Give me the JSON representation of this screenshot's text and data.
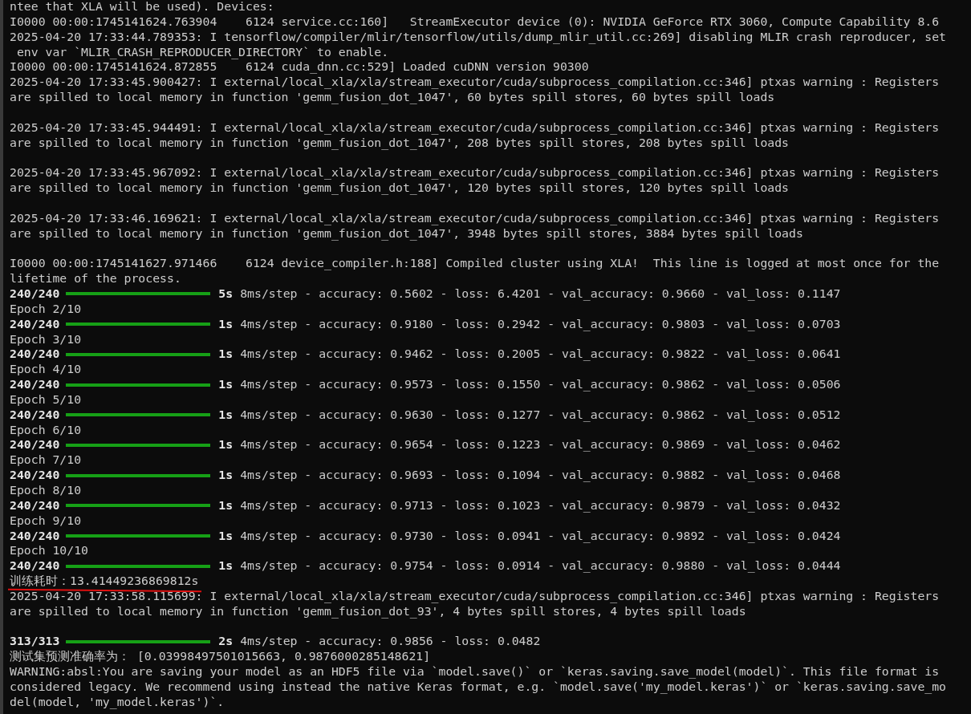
{
  "lines": [
    {
      "kind": "text",
      "text": "ntee that XLA will be used). Devices:"
    },
    {
      "kind": "text",
      "text": "I0000 00:00:1745141624.763904    6124 service.cc:160]   StreamExecutor device (0): NVIDIA GeForce RTX 3060, Compute Capability 8.6"
    },
    {
      "kind": "text",
      "text": "2025-04-20 17:33:44.789353: I tensorflow/compiler/mlir/tensorflow/utils/dump_mlir_util.cc:269] disabling MLIR crash reproducer, set"
    },
    {
      "kind": "text",
      "text": " env var `MLIR_CRASH_REPRODUCER_DIRECTORY` to enable."
    },
    {
      "kind": "text",
      "text": "I0000 00:00:1745141624.872855    6124 cuda_dnn.cc:529] Loaded cuDNN version 90300"
    },
    {
      "kind": "text",
      "text": "2025-04-20 17:33:45.900427: I external/local_xla/xla/stream_executor/cuda/subprocess_compilation.cc:346] ptxas warning : Registers"
    },
    {
      "kind": "text",
      "text": "are spilled to local memory in function 'gemm_fusion_dot_1047', 60 bytes spill stores, 60 bytes spill loads"
    },
    {
      "kind": "blank"
    },
    {
      "kind": "text",
      "text": "2025-04-20 17:33:45.944491: I external/local_xla/xla/stream_executor/cuda/subprocess_compilation.cc:346] ptxas warning : Registers"
    },
    {
      "kind": "text",
      "text": "are spilled to local memory in function 'gemm_fusion_dot_1047', 208 bytes spill stores, 208 bytes spill loads"
    },
    {
      "kind": "blank"
    },
    {
      "kind": "text",
      "text": "2025-04-20 17:33:45.967092: I external/local_xla/xla/stream_executor/cuda/subprocess_compilation.cc:346] ptxas warning : Registers"
    },
    {
      "kind": "text",
      "text": "are spilled to local memory in function 'gemm_fusion_dot_1047', 120 bytes spill stores, 120 bytes spill loads"
    },
    {
      "kind": "blank"
    },
    {
      "kind": "text",
      "text": "2025-04-20 17:33:46.169621: I external/local_xla/xla/stream_executor/cuda/subprocess_compilation.cc:346] ptxas warning : Registers"
    },
    {
      "kind": "text",
      "text": "are spilled to local memory in function 'gemm_fusion_dot_1047', 3948 bytes spill stores, 3884 bytes spill loads"
    },
    {
      "kind": "blank"
    },
    {
      "kind": "text",
      "text": "I0000 00:00:1745141627.971466    6124 device_compiler.h:188] Compiled cluster using XLA!  This line is logged at most once for the"
    },
    {
      "kind": "text",
      "text": "lifetime of the process."
    },
    {
      "kind": "progress",
      "count": "240/240",
      "level": 1,
      "time": "5s",
      "rest": "8ms/step - accuracy: 0.5602 - loss: 6.4201 - val_accuracy: 0.9660 - val_loss: 0.1147"
    },
    {
      "kind": "text",
      "text": "Epoch 2/10"
    },
    {
      "kind": "progress",
      "count": "240/240",
      "level": 1,
      "time": "1s",
      "rest": "4ms/step - accuracy: 0.9180 - loss: 0.2942 - val_accuracy: 0.9803 - val_loss: 0.0703"
    },
    {
      "kind": "text",
      "text": "Epoch 3/10"
    },
    {
      "kind": "progress",
      "count": "240/240",
      "level": 1,
      "time": "1s",
      "rest": "4ms/step - accuracy: 0.9462 - loss: 0.2005 - val_accuracy: 0.9822 - val_loss: 0.0641"
    },
    {
      "kind": "text",
      "text": "Epoch 4/10"
    },
    {
      "kind": "progress",
      "count": "240/240",
      "level": 1,
      "time": "1s",
      "rest": "4ms/step - accuracy: 0.9573 - loss: 0.1550 - val_accuracy: 0.9862 - val_loss: 0.0506"
    },
    {
      "kind": "text",
      "text": "Epoch 5/10"
    },
    {
      "kind": "progress",
      "count": "240/240",
      "level": 1,
      "time": "1s",
      "rest": "4ms/step - accuracy: 0.9630 - loss: 0.1277 - val_accuracy: 0.9862 - val_loss: 0.0512"
    },
    {
      "kind": "text",
      "text": "Epoch 6/10"
    },
    {
      "kind": "progress",
      "count": "240/240",
      "level": 1,
      "time": "1s",
      "rest": "4ms/step - accuracy: 0.9654 - loss: 0.1223 - val_accuracy: 0.9869 - val_loss: 0.0462"
    },
    {
      "kind": "text",
      "text": "Epoch 7/10"
    },
    {
      "kind": "progress",
      "count": "240/240",
      "level": 1,
      "time": "1s",
      "rest": "4ms/step - accuracy: 0.9693 - loss: 0.1094 - val_accuracy: 0.9882 - val_loss: 0.0468"
    },
    {
      "kind": "text",
      "text": "Epoch 8/10"
    },
    {
      "kind": "progress",
      "count": "240/240",
      "level": 1,
      "time": "1s",
      "rest": "4ms/step - accuracy: 0.9713 - loss: 0.1023 - val_accuracy: 0.9879 - val_loss: 0.0432"
    },
    {
      "kind": "text",
      "text": "Epoch 9/10"
    },
    {
      "kind": "progress",
      "count": "240/240",
      "level": 1,
      "time": "1s",
      "rest": "4ms/step - accuracy: 0.9730 - loss: 0.0941 - val_accuracy: 0.9892 - val_loss: 0.0424"
    },
    {
      "kind": "text",
      "text": "Epoch 10/10"
    },
    {
      "kind": "progress",
      "count": "240/240",
      "level": 1,
      "time": "1s",
      "rest": "4ms/step - accuracy: 0.9754 - loss: 0.0914 - val_accuracy: 0.9880 - val_loss: 0.0444"
    },
    {
      "kind": "text",
      "text": "训练耗时：13.41449236869812s",
      "underlined": true
    },
    {
      "kind": "text",
      "text": "2025-04-20 17:33:58.115699: I external/local_xla/xla/stream_executor/cuda/subprocess_compilation.cc:346] ptxas warning : Registers"
    },
    {
      "kind": "text",
      "text": "are spilled to local memory in function 'gemm_fusion_dot_93', 4 bytes spill stores, 4 bytes spill loads"
    },
    {
      "kind": "blank"
    },
    {
      "kind": "progress",
      "count": "313/313",
      "level": 1,
      "time": "2s",
      "rest": "4ms/step - accuracy: 0.9856 - loss: 0.0482"
    },
    {
      "kind": "text",
      "text": "测试集预测准确率为： [0.03998497501015663, 0.9876000285148621]"
    },
    {
      "kind": "text",
      "text": "WARNING:absl:You are saving your model as an HDF5 file via `model.save()` or `keras.saving.save_model(model)`. This file format is"
    },
    {
      "kind": "text",
      "text": "considered legacy. We recommend using instead the native Keras format, e.g. `model.save('my_model.keras')` or `keras.saving.save_mo"
    },
    {
      "kind": "text",
      "text": "del(model, 'my_model.keras')`."
    }
  ]
}
